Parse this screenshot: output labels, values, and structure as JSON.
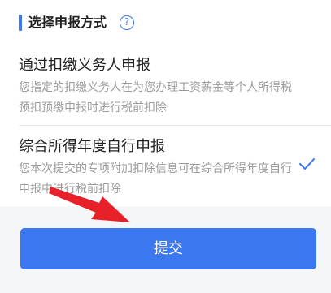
{
  "section": {
    "title": "选择申报方式",
    "help_icon": "?"
  },
  "options": [
    {
      "title": "通过扣缴义务人申报",
      "description": "您指定的扣缴义务人在为您办理工资薪金等个人所得税预扣预缴申报时进行税前扣除",
      "selected": false
    },
    {
      "title": "综合所得年度自行申报",
      "description": "您本次提交的专项附加扣除信息可在综合所得年度自行申报中进行税前扣除",
      "selected": true
    }
  ],
  "submit": {
    "label": "提交"
  },
  "colors": {
    "accent": "#3b78f0",
    "annotation_arrow": "#e8202a"
  },
  "icons": {
    "check": "check-icon",
    "help": "question-circle-icon",
    "annotation": "red-arrow-annotation"
  }
}
